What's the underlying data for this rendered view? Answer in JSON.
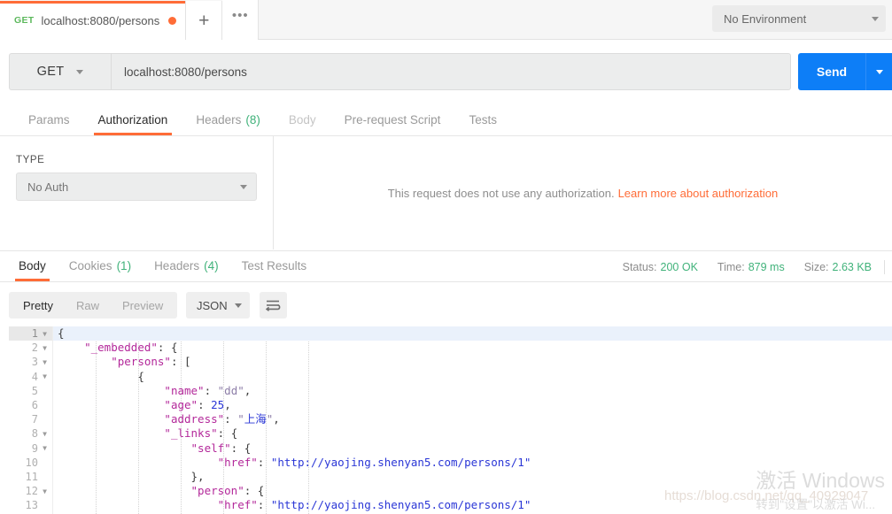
{
  "tab": {
    "method": "GET",
    "name": "localhost:8080/persons",
    "unsaved_dot": "unsaved-indicator",
    "new_tab_label": "+",
    "more_label": "•••"
  },
  "environment": {
    "selected": "No Environment"
  },
  "request": {
    "method": "GET",
    "url": "localhost:8080/persons",
    "send_label": "Send",
    "tabs": [
      {
        "label": "Params",
        "active": false,
        "dim": false,
        "count": ""
      },
      {
        "label": "Authorization",
        "active": true,
        "dim": false,
        "count": ""
      },
      {
        "label": "Headers",
        "active": false,
        "dim": false,
        "count": "(8)"
      },
      {
        "label": "Body",
        "active": false,
        "dim": true,
        "count": ""
      },
      {
        "label": "Pre-request Script",
        "active": false,
        "dim": false,
        "count": ""
      },
      {
        "label": "Tests",
        "active": false,
        "dim": false,
        "count": ""
      }
    ]
  },
  "authorization": {
    "type_label": "TYPE",
    "type_value": "No Auth",
    "message": "This request does not use any authorization.",
    "link": "Learn more about authorization"
  },
  "response": {
    "tabs": [
      {
        "label": "Body",
        "active": true,
        "count": ""
      },
      {
        "label": "Cookies",
        "active": false,
        "count": "(1)"
      },
      {
        "label": "Headers",
        "active": false,
        "count": "(4)"
      },
      {
        "label": "Test Results",
        "active": false,
        "count": ""
      }
    ],
    "status_label": "Status:",
    "status_value": "200 OK",
    "time_label": "Time:",
    "time_value": "879 ms",
    "size_label": "Size:",
    "size_value": "2.63 KB",
    "view_modes": [
      {
        "label": "Pretty",
        "active": true
      },
      {
        "label": "Raw",
        "active": false
      },
      {
        "label": "Preview",
        "active": false
      }
    ],
    "format": "JSON",
    "wrap_icon": "wrap-lines-icon"
  },
  "code": {
    "lines": [
      {
        "num": "1",
        "fold": true,
        "current": true,
        "indent": 0,
        "tokens": [
          {
            "t": "{",
            "c": "p"
          }
        ]
      },
      {
        "num": "2",
        "fold": true,
        "current": false,
        "indent": 1,
        "tokens": [
          {
            "t": "\"_embedded\"",
            "c": "k"
          },
          {
            "t": ": {",
            "c": "p"
          }
        ]
      },
      {
        "num": "3",
        "fold": true,
        "current": false,
        "indent": 2,
        "tokens": [
          {
            "t": "\"persons\"",
            "c": "k"
          },
          {
            "t": ": [",
            "c": "p"
          }
        ]
      },
      {
        "num": "4",
        "fold": true,
        "current": false,
        "indent": 3,
        "tokens": [
          {
            "t": "{",
            "c": "p"
          }
        ]
      },
      {
        "num": "5",
        "fold": false,
        "current": false,
        "indent": 4,
        "tokens": [
          {
            "t": "\"name\"",
            "c": "k"
          },
          {
            "t": ": ",
            "c": "p"
          },
          {
            "t": "\"dd\"",
            "c": "s"
          },
          {
            "t": ",",
            "c": "p"
          }
        ]
      },
      {
        "num": "6",
        "fold": false,
        "current": false,
        "indent": 4,
        "tokens": [
          {
            "t": "\"age\"",
            "c": "k"
          },
          {
            "t": ": ",
            "c": "p"
          },
          {
            "t": "25",
            "c": "n"
          },
          {
            "t": ",",
            "c": "p"
          }
        ]
      },
      {
        "num": "7",
        "fold": false,
        "current": false,
        "indent": 4,
        "tokens": [
          {
            "t": "\"address\"",
            "c": "k"
          },
          {
            "t": ": ",
            "c": "p"
          },
          {
            "t": "\"",
            "c": "s"
          },
          {
            "t": "上海",
            "c": "cjk"
          },
          {
            "t": "\"",
            "c": "s"
          },
          {
            "t": ",",
            "c": "p"
          }
        ]
      },
      {
        "num": "8",
        "fold": true,
        "current": false,
        "indent": 4,
        "tokens": [
          {
            "t": "\"_links\"",
            "c": "k"
          },
          {
            "t": ": {",
            "c": "p"
          }
        ]
      },
      {
        "num": "9",
        "fold": true,
        "current": false,
        "indent": 5,
        "tokens": [
          {
            "t": "\"self\"",
            "c": "k"
          },
          {
            "t": ": {",
            "c": "p"
          }
        ]
      },
      {
        "num": "10",
        "fold": false,
        "current": false,
        "indent": 6,
        "tokens": [
          {
            "t": "\"href\"",
            "c": "k"
          },
          {
            "t": ": ",
            "c": "p"
          },
          {
            "t": "\"http://yaojing.shenyan5.com/persons/1\"",
            "c": "b"
          }
        ]
      },
      {
        "num": "11",
        "fold": false,
        "current": false,
        "indent": 5,
        "tokens": [
          {
            "t": "},",
            "c": "p"
          }
        ]
      },
      {
        "num": "12",
        "fold": true,
        "current": false,
        "indent": 5,
        "tokens": [
          {
            "t": "\"person\"",
            "c": "k"
          },
          {
            "t": ": {",
            "c": "p"
          }
        ]
      },
      {
        "num": "13",
        "fold": false,
        "current": false,
        "indent": 6,
        "tokens": [
          {
            "t": "\"href\"",
            "c": "k"
          },
          {
            "t": ": ",
            "c": "p"
          },
          {
            "t": "\"http://yaojing.shenyan5.com/persons/1\"",
            "c": "b"
          }
        ]
      }
    ]
  },
  "watermarks": {
    "csdn": "https://blog.csdn.net/qq_40929047",
    "windows_line1": "激活 Windows",
    "windows_line2": "转到\"设置\"以激活 Wi..."
  },
  "colors": {
    "accent": "#ff6c37",
    "send": "#0d7ef7",
    "success": "#40b27a",
    "method": "#5cb85c"
  }
}
